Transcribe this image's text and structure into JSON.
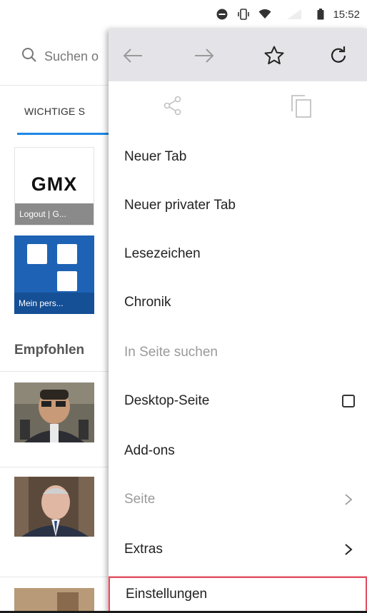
{
  "status_bar": {
    "time": "15:52",
    "icons": [
      "do-not-disturb-icon",
      "vibrate-icon",
      "wifi-icon",
      "battery-icon"
    ]
  },
  "background_page": {
    "search_placeholder": "Suchen o",
    "tab_label": "WICHTIGE S",
    "tiles": [
      {
        "logo": "GMX",
        "caption": "Logout | G..."
      },
      {
        "caption": "Mein pers..."
      }
    ],
    "section_heading": "Empfohlen"
  },
  "menu": {
    "toolbar_icons": [
      "back-arrow-icon",
      "forward-arrow-icon",
      "star-icon",
      "reload-icon"
    ],
    "secondary_icons": [
      "share-icon",
      "copy-icon"
    ],
    "items": [
      {
        "label": "Neuer Tab"
      },
      {
        "label": "Neuer privater Tab"
      },
      {
        "label": "Lesezeichen"
      },
      {
        "label": "Chronik"
      },
      {
        "label": "In Seite suchen"
      },
      {
        "label": "Desktop-Seite"
      },
      {
        "label": "Add-ons"
      },
      {
        "label": "Seite"
      },
      {
        "label": "Extras"
      },
      {
        "label": "Einstellungen"
      }
    ]
  },
  "colors": {
    "accent_blue": "#1e88e5",
    "menu_toolbar_bg": "#e4e4e8",
    "highlight_border": "#e05060",
    "tile_blue": "#1d62b4"
  }
}
